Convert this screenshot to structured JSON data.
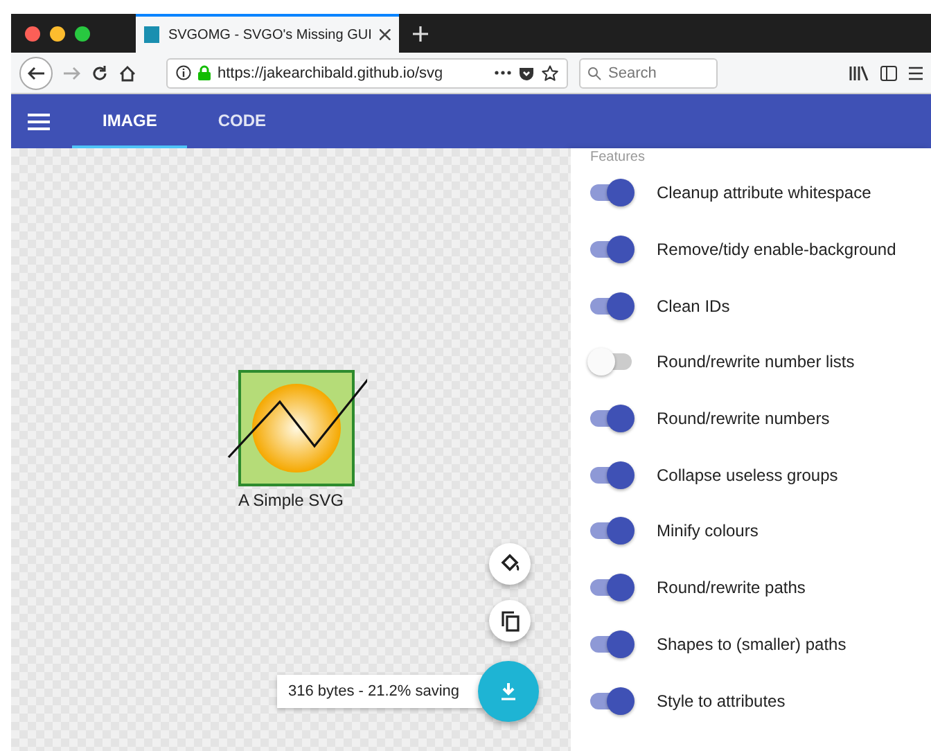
{
  "browser": {
    "tab_title": "SVGOMG - SVGO's Missing GUI",
    "url": "https://jakearchibald.github.io/svg",
    "search": {
      "placeholder": "Search"
    }
  },
  "app_bar": {
    "tabs": [
      {
        "label": "IMAGE",
        "selected": true
      },
      {
        "label": "CODE",
        "selected": false
      }
    ]
  },
  "preview": {
    "caption": "A Simple SVG",
    "result": "316 bytes - 21.2% saving"
  },
  "settings": {
    "section": "Features",
    "items": [
      {
        "label": "Cleanup attribute whitespace",
        "on": true
      },
      {
        "label": "Remove/tidy enable-background",
        "on": true
      },
      {
        "label": "Clean IDs",
        "on": true
      },
      {
        "label": "Round/rewrite number lists",
        "on": false
      },
      {
        "label": "Round/rewrite numbers",
        "on": true
      },
      {
        "label": "Collapse useless groups",
        "on": true
      },
      {
        "label": "Minify colours",
        "on": true
      },
      {
        "label": "Round/rewrite paths",
        "on": true
      },
      {
        "label": "Shapes to (smaller) paths",
        "on": true
      },
      {
        "label": "Style to attributes",
        "on": true
      }
    ]
  }
}
